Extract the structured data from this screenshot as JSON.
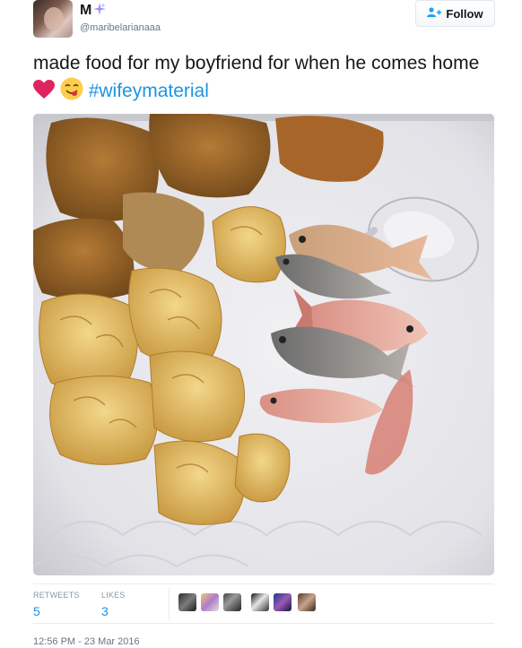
{
  "author": {
    "name": "M",
    "handle": "@maribelarianaaa",
    "sparkle_icon": "sparkles-emoji"
  },
  "follow_button": {
    "label": "Follow",
    "icon": "add-user-icon"
  },
  "tweet": {
    "text": "made food for my boyfriend for when he comes home",
    "emojis": [
      "red-heart-emoji",
      "yum-face-emoji"
    ],
    "hashtag": "#wifeymaterial"
  },
  "media": {
    "description_icon": "photo-of-plate"
  },
  "stats": {
    "retweets_label": "RETWEETS",
    "retweets_value": "5",
    "likes_label": "LIKES",
    "likes_value": "3"
  },
  "likers": [
    "avatar-1",
    "avatar-2",
    "avatar-3",
    "avatar-4",
    "avatar-5",
    "avatar-6"
  ],
  "timestamp": "12:56 PM - 23 Mar 2016",
  "colors": {
    "link": "#1b95e0",
    "muted": "#657786",
    "divider": "#e6ecf0"
  }
}
